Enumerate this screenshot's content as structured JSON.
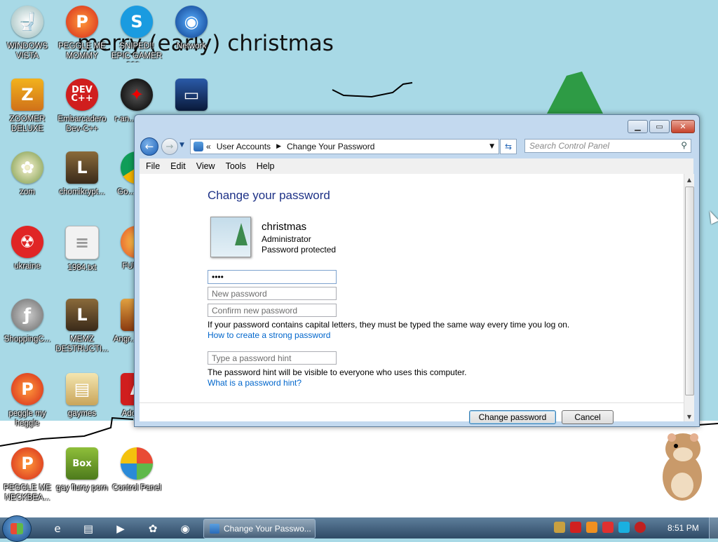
{
  "wallpaper": {
    "text": "merry (early) christmas"
  },
  "desktop_icons": [
    {
      "label": "WINDOWS VISTA",
      "icon": "toilet-icon"
    },
    {
      "label": "PEGGLE ME MOMMY",
      "icon": "peggle-icon"
    },
    {
      "label": "SNIPED!! EPIC GAMER 360...",
      "icon": "skype-icon"
    },
    {
      "label": "Network",
      "icon": "network-globe-icon"
    },
    {
      "label": "ZOOMER DELUXE",
      "icon": "zoomer-icon"
    },
    {
      "label": "Embarcadero Dev-C++",
      "icon": "devcpp-icon"
    },
    {
      "label": "r-an... part...",
      "icon": "red-disc-icon"
    },
    {
      "label": "",
      "icon": "monitor-icon"
    },
    {
      "label": "zom",
      "icon": "plants-zombies-icon"
    },
    {
      "label": "chomikrypt...",
      "icon": "shortcut-l-icon"
    },
    {
      "label": "Go... Chr...",
      "icon": "chrome-icon"
    },
    {
      "label": "ukraine",
      "icon": "radiation-icon"
    },
    {
      "label": "1984.txt",
      "icon": "text-file-icon"
    },
    {
      "label": "FURR...",
      "icon": "firefox-icon"
    },
    {
      "label": "ShoppingC...",
      "icon": "flash-icon"
    },
    {
      "label": "MEMZ DESTRUCTI...",
      "icon": "shortcut-l-icon"
    },
    {
      "label": "Angr... Sea...",
      "icon": "angry-birds-icon"
    },
    {
      "label": "peggle my heggle",
      "icon": "peggle-icon"
    },
    {
      "label": "gaymes",
      "icon": "folder-icon"
    },
    {
      "label": "Adobe...",
      "icon": "adobe-icon"
    },
    {
      "label": "PEGGLE ME NECKBEA...",
      "icon": "peggle-icon"
    },
    {
      "label": "gay flurry porn",
      "icon": "box-bear-icon"
    },
    {
      "label": "Control Panel",
      "icon": "control-panel-icon"
    }
  ],
  "window": {
    "breadcrumb": [
      "User Accounts",
      "Change Your Password"
    ],
    "breadcrumb_prefix": "«",
    "search_placeholder": "Search Control Panel",
    "menu": [
      "File",
      "Edit",
      "View",
      "Tools",
      "Help"
    ],
    "heading": "Change your password",
    "user": {
      "name": "christmas",
      "role": "Administrator",
      "status": "Password protected"
    },
    "current_password_value": "••••",
    "new_password_placeholder": "New password",
    "confirm_password_placeholder": "Confirm new password",
    "caps_note": "If your password contains capital letters, they must be typed the same way every time you log on.",
    "strong_password_link": "How to create a strong password",
    "hint_placeholder": "Type a password hint",
    "hint_note": "The password hint will be visible to everyone who uses this computer.",
    "hint_link": "What is a password hint?",
    "change_button": "Change password",
    "cancel_button": "Cancel"
  },
  "taskbar": {
    "active_task": "Change Your Passwo...",
    "clock": "8:51 PM"
  },
  "colors": {
    "desktop_bg": "#a8d9e6",
    "link": "#0066cc",
    "heading": "#1e3287"
  }
}
